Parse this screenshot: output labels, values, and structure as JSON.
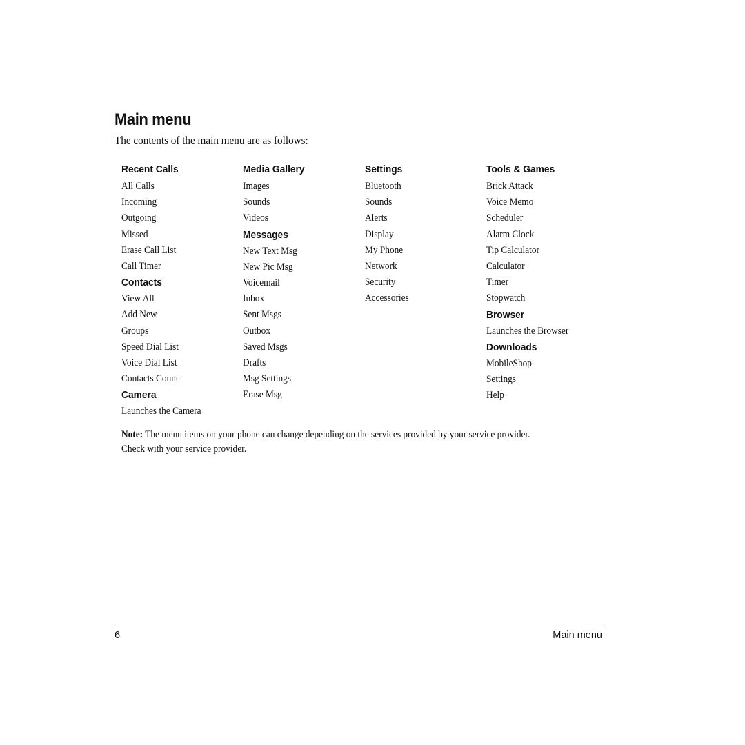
{
  "page": {
    "title": "Main menu",
    "intro": "The contents of the main menu are as follows:"
  },
  "columns": [
    {
      "groups": [
        {
          "heading": "Recent Calls",
          "items": [
            "All Calls",
            "Incoming",
            "Outgoing",
            "Missed",
            "Erase Call List",
            "Call Timer"
          ]
        },
        {
          "heading": "Contacts",
          "items": [
            "View All",
            "Add New",
            "Groups",
            "Speed Dial List",
            "Voice Dial List",
            "Contacts Count"
          ]
        },
        {
          "heading": "Camera",
          "items": [
            "Launches the Camera"
          ]
        }
      ]
    },
    {
      "groups": [
        {
          "heading": "Media Gallery",
          "items": [
            "Images",
            "Sounds",
            "Videos"
          ]
        },
        {
          "heading": "Messages",
          "items": [
            "New Text Msg",
            "New Pic Msg",
            "Voicemail",
            "Inbox",
            "Sent Msgs",
            "Outbox",
            "Saved Msgs",
            "Drafts",
            "Msg Settings",
            "Erase Msg"
          ]
        }
      ]
    },
    {
      "groups": [
        {
          "heading": "Settings",
          "items": [
            "Bluetooth",
            "Sounds",
            "Alerts",
            "Display",
            "My Phone",
            "Network",
            "Security",
            "Accessories"
          ]
        }
      ]
    },
    {
      "groups": [
        {
          "heading": "Tools & Games",
          "items": [
            "Brick Attack",
            "Voice Memo",
            "Scheduler",
            "Alarm Clock",
            "Tip Calculator",
            "Calculator",
            "Timer",
            "Stopwatch"
          ]
        },
        {
          "heading": "Browser",
          "items": [
            "Launches the Browser"
          ]
        },
        {
          "heading": "Downloads",
          "items": [
            "MobileShop",
            "Settings",
            "Help"
          ]
        }
      ]
    }
  ],
  "note": {
    "label": "Note:",
    "line1": " The menu items on your phone can change depending on the services provided by your service provider.",
    "line2": "Check with your service provider."
  },
  "footer": {
    "page_number": "6",
    "section": "Main menu"
  }
}
